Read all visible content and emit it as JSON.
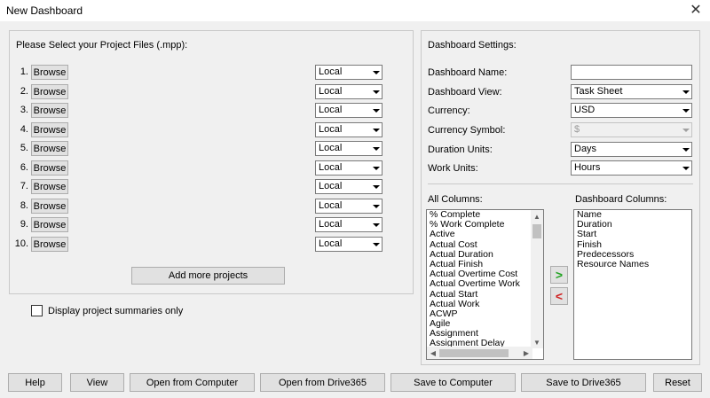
{
  "window": {
    "title": "New Dashboard"
  },
  "files": {
    "heading": "Please Select your Project Files (.mpp):",
    "rows": [
      {
        "num": "1.",
        "browse": "Browse",
        "location": "Local"
      },
      {
        "num": "2.",
        "browse": "Browse",
        "location": "Local"
      },
      {
        "num": "3.",
        "browse": "Browse",
        "location": "Local"
      },
      {
        "num": "4.",
        "browse": "Browse",
        "location": "Local"
      },
      {
        "num": "5.",
        "browse": "Browse",
        "location": "Local"
      },
      {
        "num": "6.",
        "browse": "Browse",
        "location": "Local"
      },
      {
        "num": "7.",
        "browse": "Browse",
        "location": "Local"
      },
      {
        "num": "8.",
        "browse": "Browse",
        "location": "Local"
      },
      {
        "num": "9.",
        "browse": "Browse",
        "location": "Local"
      },
      {
        "num": "10.",
        "browse": "Browse",
        "location": "Local"
      }
    ],
    "add_more": "Add more projects"
  },
  "summaries_label": "Display project summaries only",
  "settings": {
    "heading": "Dashboard Settings:",
    "name_label": "Dashboard Name:",
    "name_value": "",
    "view_label": "Dashboard View:",
    "view_value": "Task Sheet",
    "currency_label": "Currency:",
    "currency_value": "USD",
    "symbol_label": "Currency Symbol:",
    "symbol_value": "$",
    "duration_label": "Duration Units:",
    "duration_value": "Days",
    "work_label": "Work Units:",
    "work_value": "Hours"
  },
  "columns": {
    "all_label": "All Columns:",
    "all_items": [
      "% Complete",
      "% Work Complete",
      "Active",
      "Actual Cost",
      "Actual Duration",
      "Actual Finish",
      "Actual Overtime Cost",
      "Actual Overtime Work",
      "Actual Start",
      "Actual Work",
      "ACWP",
      "Agile",
      "Assignment",
      "Assignment Delay"
    ],
    "dashboard_label": "Dashboard Columns:",
    "dashboard_items": [
      "Name",
      "Duration",
      "Start",
      "Finish",
      "Predecessors",
      "Resource Names"
    ],
    "add_symbol": ">",
    "remove_symbol": "<"
  },
  "buttons": {
    "help": "Help",
    "view": "View",
    "open_computer": "Open from Computer",
    "open_drive": "Open from Drive365",
    "save_computer": "Save to Computer",
    "save_drive": "Save to Drive365",
    "reset": "Reset"
  }
}
